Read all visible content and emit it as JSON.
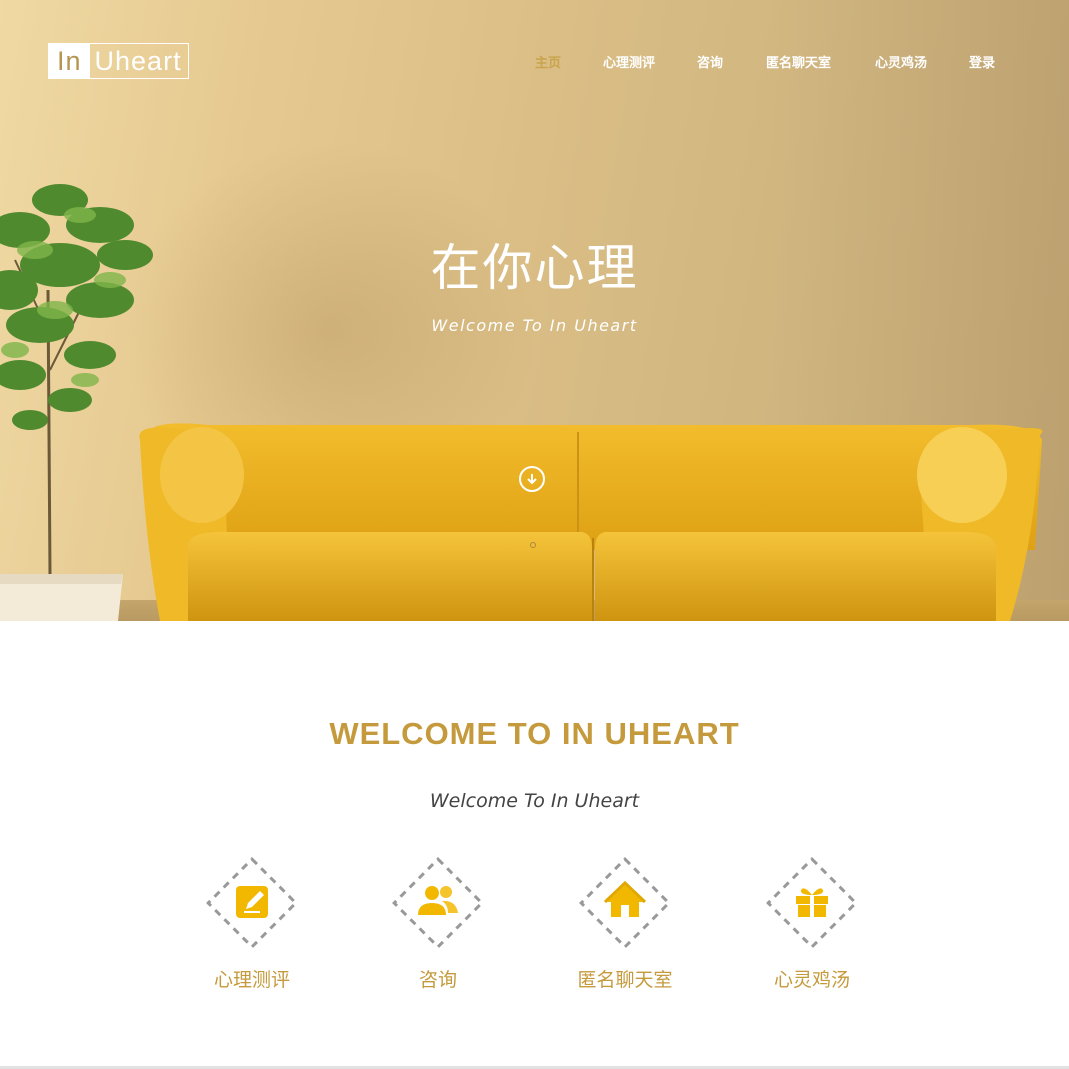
{
  "brand": {
    "logo_part1": "In",
    "logo_part2": "Uheart"
  },
  "nav": {
    "items": [
      {
        "label": "主页",
        "active": true
      },
      {
        "label": "心理测评",
        "active": false
      },
      {
        "label": "咨询",
        "active": false
      },
      {
        "label": "匿名聊天室",
        "active": false
      },
      {
        "label": "心灵鸡汤",
        "active": false
      },
      {
        "label": "登录",
        "active": false
      }
    ]
  },
  "hero": {
    "title": "在你心理",
    "subtitle": "Welcome To In Uheart",
    "scroll_icon": "arrow-down-circle-icon"
  },
  "welcome": {
    "title": "WELCOME TO IN UHEART",
    "subtitle": "Welcome To In Uheart"
  },
  "features": [
    {
      "label": "心理测评",
      "icon": "edit-note-icon"
    },
    {
      "label": "咨询",
      "icon": "users-icon"
    },
    {
      "label": "匿名聊天室",
      "icon": "home-icon"
    },
    {
      "label": "心灵鸡汤",
      "icon": "gift-icon"
    }
  ],
  "colors": {
    "accent": "#c59a3c",
    "nav_active": "#c9a44c",
    "icon_gold": "#f2b800",
    "hero_wall": "#dcc089",
    "sofa": "#e8b01e"
  }
}
